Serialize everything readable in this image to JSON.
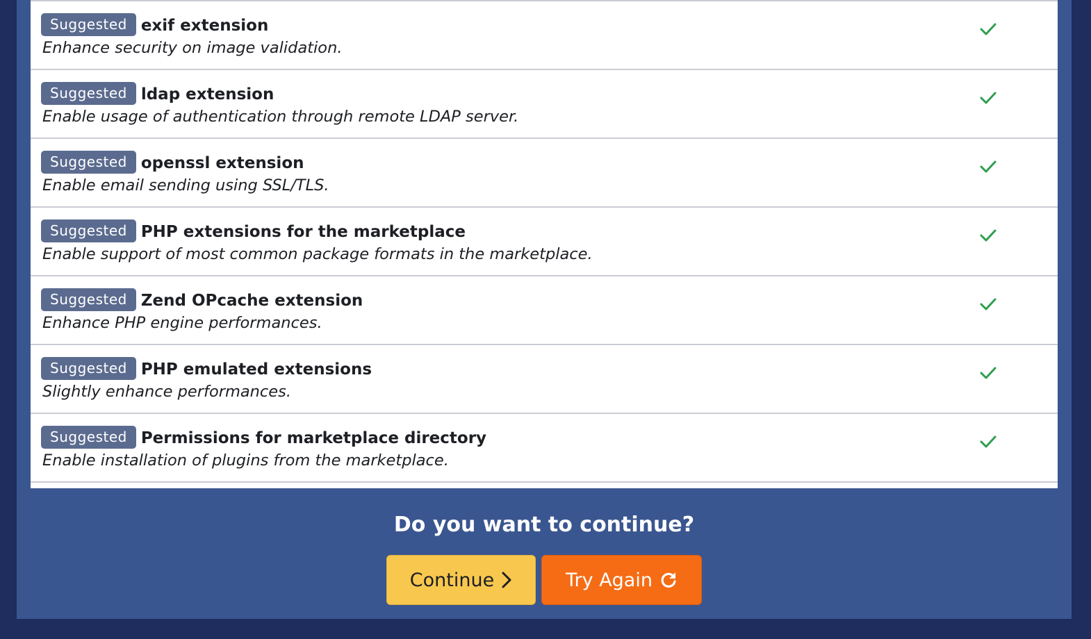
{
  "requirements": [
    {
      "badge": "Suggested",
      "title": "exif extension",
      "description": "Enhance security on image validation."
    },
    {
      "badge": "Suggested",
      "title": "ldap extension",
      "description": "Enable usage of authentication through remote LDAP server."
    },
    {
      "badge": "Suggested",
      "title": "openssl extension",
      "description": "Enable email sending using SSL/TLS."
    },
    {
      "badge": "Suggested",
      "title": "PHP extensions for the marketplace",
      "description": "Enable support of most common package formats in the marketplace."
    },
    {
      "badge": "Suggested",
      "title": "Zend OPcache extension",
      "description": "Enhance PHP engine performances."
    },
    {
      "badge": "Suggested",
      "title": "PHP emulated extensions",
      "description": "Slightly enhance performances."
    },
    {
      "badge": "Suggested",
      "title": "Permissions for marketplace directory",
      "description": "Enable installation of plugins from the marketplace."
    }
  ],
  "footer": {
    "question": "Do you want to continue?",
    "continue_label": "Continue",
    "try_again_label": "Try Again"
  },
  "icons": {
    "status": "check-icon",
    "continue": "chevron-right-icon",
    "try_again": "redo-icon"
  },
  "colors": {
    "background": "#1e2d5e",
    "panel": "#3a5690",
    "badge": "#5b6b8f",
    "check": "#2e9e4f",
    "continue_button": "#f8c84e",
    "try_again_button": "#f56c15"
  }
}
